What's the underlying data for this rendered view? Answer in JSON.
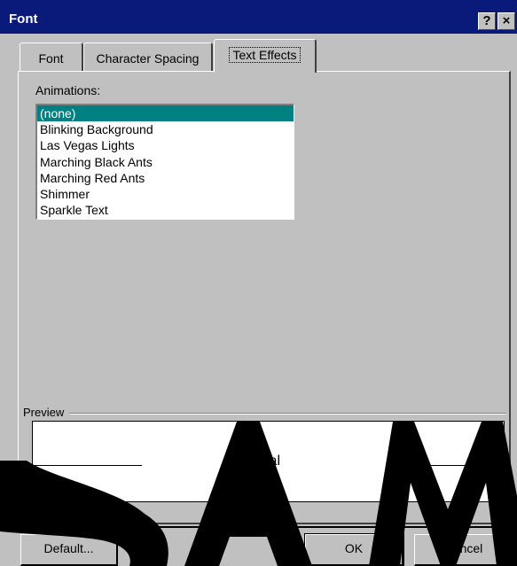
{
  "window": {
    "title": "Font",
    "help_button": "?",
    "close_button": "×"
  },
  "tabs": [
    {
      "label": "Font"
    },
    {
      "label": "Character Spacing"
    },
    {
      "label": "Text Effects"
    }
  ],
  "animations": {
    "label": "Animations:",
    "items": [
      "(none)",
      "Blinking Background",
      "Las Vegas Lights",
      "Marching Black Ants",
      "Marching Red Ants",
      "Shimmer",
      "Sparkle Text"
    ],
    "selected": "(none)"
  },
  "preview": {
    "label": "Preview",
    "text": "Arial"
  },
  "buttons": {
    "default": "Default...",
    "ok": "OK",
    "cancel": "Cancel"
  },
  "watermark": {
    "text": "SAMPLE"
  },
  "colors": {
    "title_bar": "#0a1a7a",
    "selection": "#008080",
    "dialog": "#c0c0c0"
  }
}
